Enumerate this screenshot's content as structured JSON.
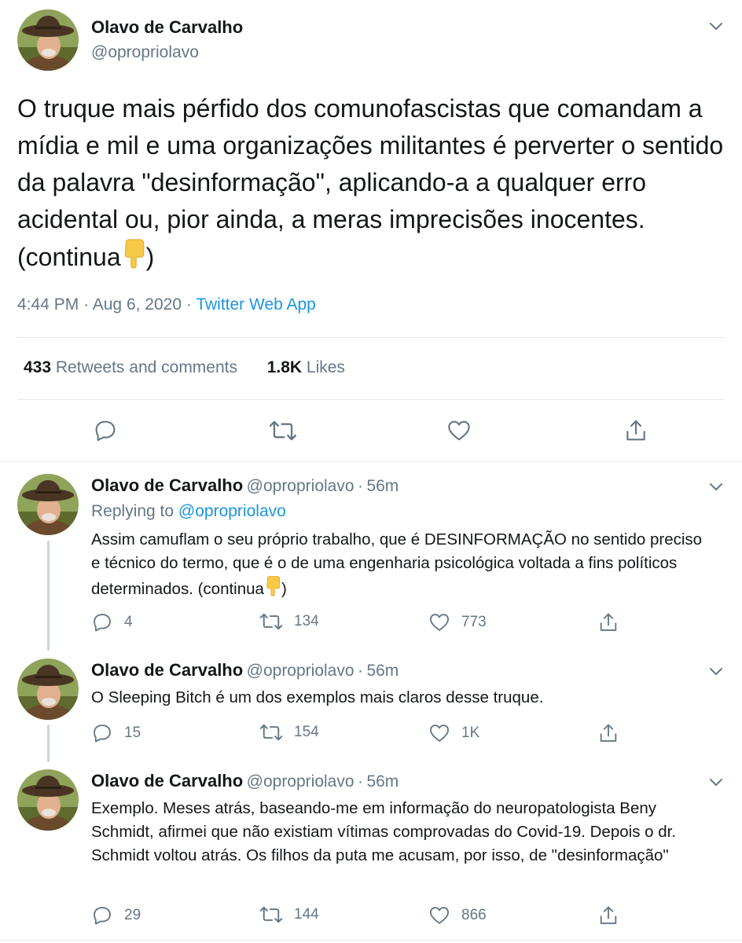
{
  "main_tweet": {
    "author_name": "Olavo de Carvalho",
    "author_handle": "@opropriolavo",
    "text": "O truque mais pérfido dos comunofascistas que comandam a mídia e mil e uma organizações militantes é perverter o sentido da palavra \"desinformação\", aplicando-a a qualquer erro acidental ou, pior ainda, a meras imprecisões inocentes. (continua",
    "text_end": ")",
    "time": "4:44 PM",
    "date": "Aug 6, 2020",
    "source": "Twitter Web App",
    "retweets_count": "433",
    "retweets_label": "Retweets and comments",
    "likes_count": "1.8K",
    "likes_label": "Likes"
  },
  "replies": [
    {
      "author_name": "Olavo de Carvalho",
      "author_handle": "@opropriolavo",
      "time": "56m",
      "replying_prefix": "Replying to",
      "replying_to": "@opropriolavo",
      "text": "Assim camuflam o seu próprio trabalho, que é DESINFORMAÇÃO no sentido preciso e técnico do termo, que é o de uma engenharia psicológica voltada a fins políticos determinados. (continua",
      "text_end": ")",
      "replies": "4",
      "retweets": "134",
      "likes": "773"
    },
    {
      "author_name": "Olavo de Carvalho",
      "author_handle": "@opropriolavo",
      "time": "56m",
      "text": "O Sleeping Bitch é um dos exemplos mais claros desse truque.",
      "replies": "15",
      "retweets": "154",
      "likes": "1K"
    },
    {
      "author_name": "Olavo de Carvalho",
      "author_handle": "@opropriolavo",
      "time": "56m",
      "text": "Exemplo. Meses atrás, baseando-me em informação do neuropatologista Beny Schmidt, afirmei que não existiam vítimas comprovadas do Covid-19. Depois o dr. Schmidt voltou atrás. Os filhos da puta me acusam, por isso, de \"desinformação\"",
      "replies": "29",
      "retweets": "144",
      "likes": "866"
    }
  ],
  "separator": "·",
  "icons": {
    "reply": "reply-icon",
    "retweet": "retweet-icon",
    "like": "heart-icon",
    "share": "share-icon",
    "more": "chevron-down-icon",
    "emoji": "backhand-index-pointing-down-emoji"
  },
  "colors": {
    "text": "#14171a",
    "secondary": "#657786",
    "link": "#1b95e0",
    "divider": "#e1e8ed",
    "thread_line": "#ccd6dd",
    "emoji": "#f7c948"
  }
}
